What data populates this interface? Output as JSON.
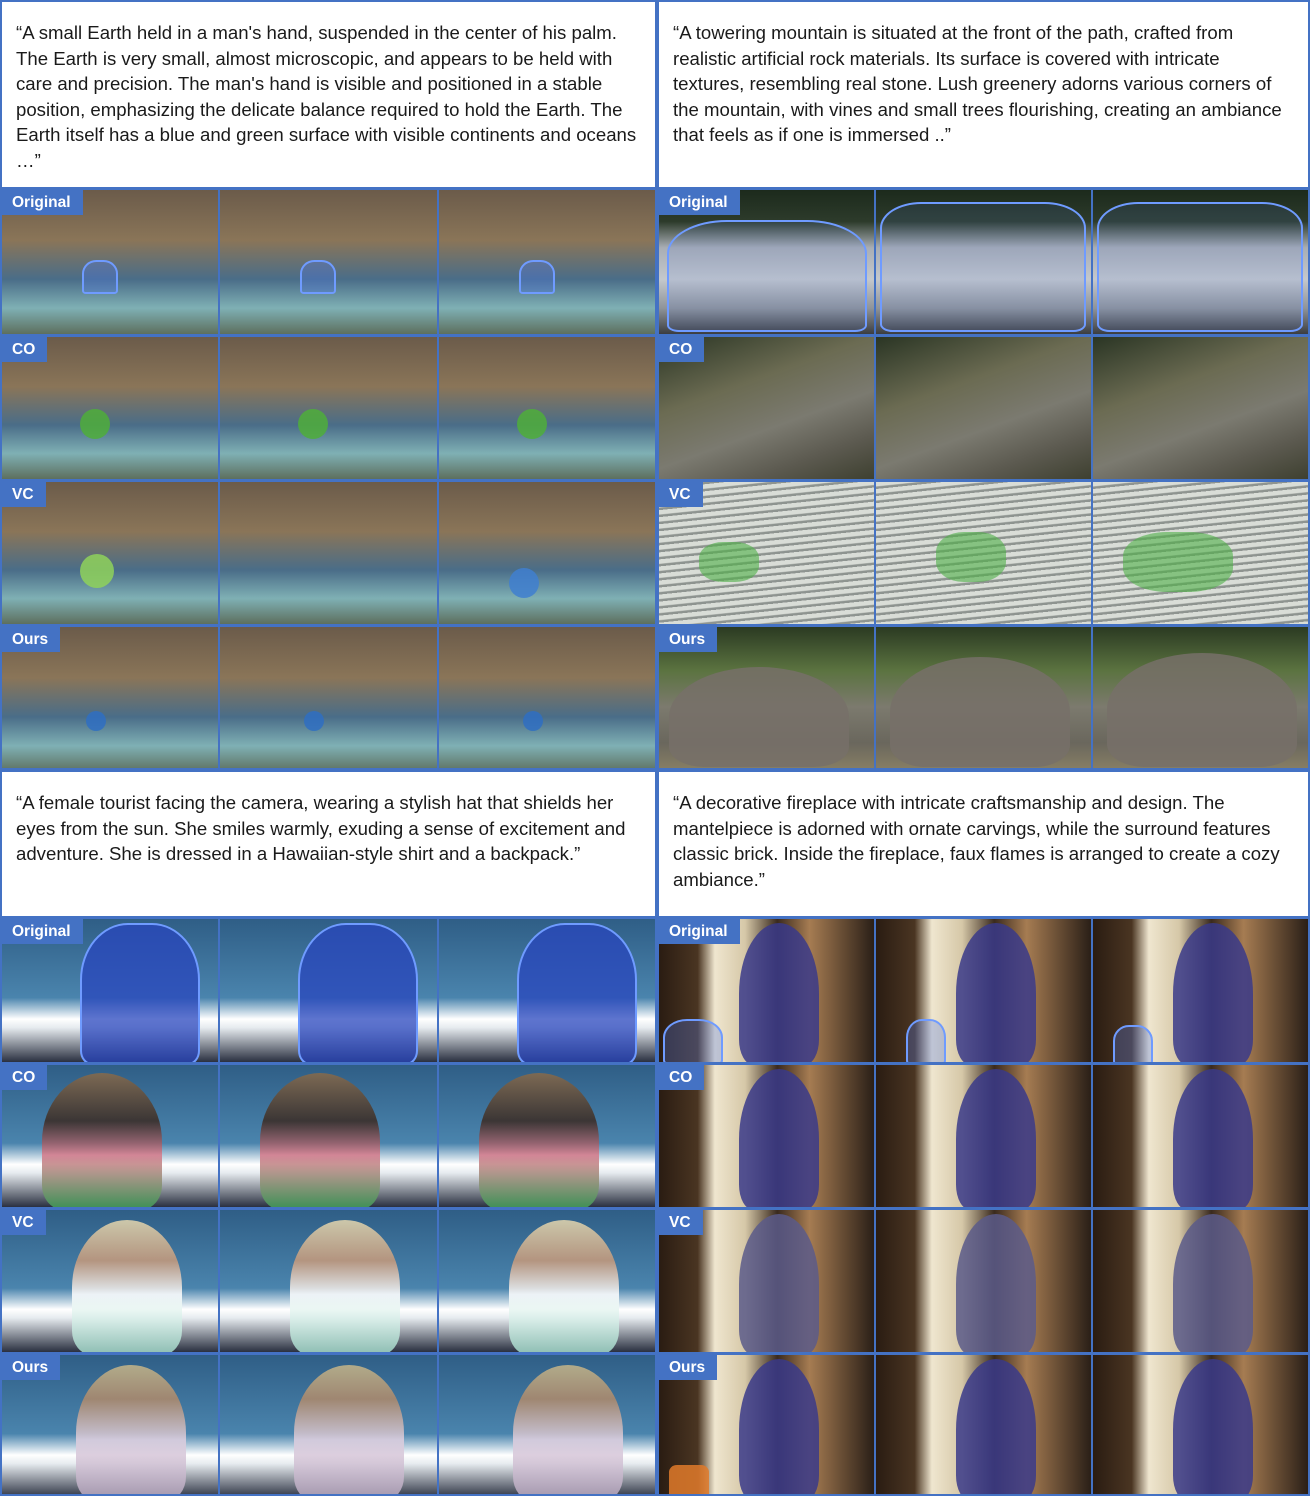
{
  "colors": {
    "accent": "#4472c4",
    "mask": "#6f9bff"
  },
  "panels": [
    {
      "prompt": "“A small Earth held in a man's hand, suspended in the center of his palm. The Earth is very small, almost microscopic, and appears to be held with care and precision. The man's hand is visible and positioned in a stable position, emphasizing the delicate balance required to hold the Earth. The Earth itself has a blue and green surface with visible continents and oceans …”",
      "rows": [
        "Original",
        "CO",
        "VC",
        "Ours"
      ]
    },
    {
      "prompt": "“A towering mountain is situated at the front of the path, crafted from realistic artificial rock materials. Its surface is covered with intricate textures, resembling real stone. Lush greenery adorns various corners of the mountain, with vines and small trees flourishing, creating an ambiance that feels as if one is immersed ..”",
      "rows": [
        "Original",
        "CO",
        "VC",
        "Ours"
      ]
    },
    {
      "prompt": "“A female tourist facing the camera, wearing a stylish hat that shields her eyes from the sun. She smiles warmly, exuding a sense of excitement and adventure. She is dressed in a Hawaiian-style shirt and a backpack.”",
      "rows": [
        "Original",
        "CO",
        "VC",
        "Ours"
      ]
    },
    {
      "prompt": "“A decorative fireplace with intricate craftsmanship and design. The mantelpiece is adorned with ornate carvings, while the surround features classic brick. Inside the fireplace, faux flames is arranged to create a cozy ambiance.”",
      "rows": [
        "Original",
        "CO",
        "VC",
        "Ours"
      ]
    }
  ]
}
